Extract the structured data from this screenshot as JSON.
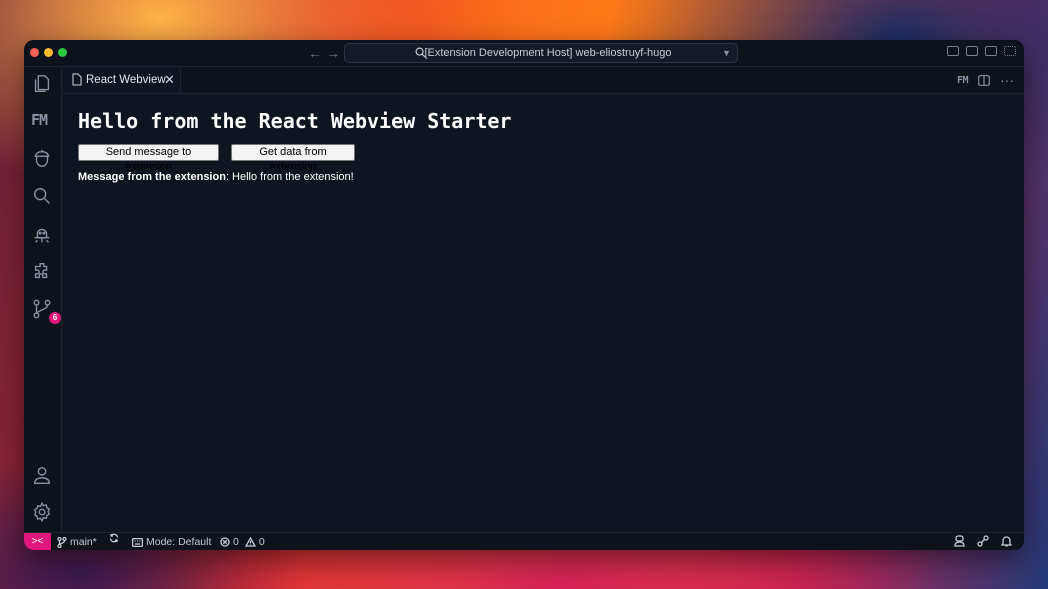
{
  "titlebar": {
    "command_center": "[Extension Development Host] web-eliostruyf-hugo"
  },
  "activity_bar": {
    "items": [
      {
        "name": "explorer",
        "icon": "files-icon"
      },
      {
        "name": "front-matter",
        "icon": "fm-icon",
        "text": "FM"
      },
      {
        "name": "acorn",
        "icon": "acorn-icon"
      },
      {
        "name": "search",
        "icon": "search-icon"
      },
      {
        "name": "run-debug",
        "icon": "bug-icon"
      },
      {
        "name": "extensions",
        "icon": "puzzle-icon"
      },
      {
        "name": "source-control",
        "icon": "git-branch-icon",
        "badge": "6"
      }
    ],
    "bottom": [
      {
        "name": "accounts",
        "icon": "account-icon"
      },
      {
        "name": "manage",
        "icon": "gear-icon"
      }
    ]
  },
  "tabbar": {
    "active_tab": "React Webview",
    "actions_fm": "FM"
  },
  "webview": {
    "heading": "Hello from the React Webview Starter",
    "button_send": "Send message to extension",
    "button_get": "Get data from extension",
    "message_label": "Message from the extension",
    "message_value": ": Hello from the extension!"
  },
  "statusbar": {
    "branch": "main*",
    "mode": "Mode: Default",
    "errors": "0",
    "warnings": "0"
  },
  "colors": {
    "accent": "#e0167c",
    "editor_bg": "#0f1520"
  }
}
